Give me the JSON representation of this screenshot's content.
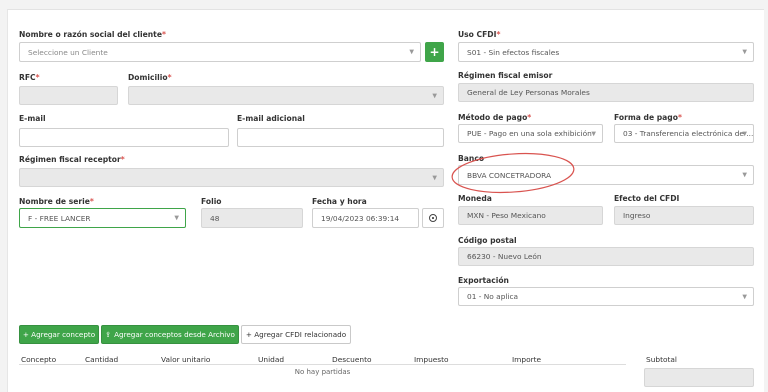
{
  "client": {
    "label": "Nombre o razón social del cliente",
    "placeholder": "Seleccione un Cliente",
    "add_button": "+"
  },
  "rfc": {
    "label": "RFC"
  },
  "domicilio": {
    "label": "Domicilio"
  },
  "email": {
    "label": "E-mail"
  },
  "email_adicional": {
    "label": "E-mail adicional"
  },
  "regimen_receptor": {
    "label": "Régimen fiscal receptor"
  },
  "serie": {
    "label": "Nombre de serie",
    "value": "F - FREE LANCER"
  },
  "folio": {
    "label": "Folio",
    "value": "48"
  },
  "fecha": {
    "label": "Fecha y hora",
    "value": "19/04/2023 06:39:14"
  },
  "uso_cfdi": {
    "label": "Uso CFDI",
    "value": "S01 - Sin efectos fiscales"
  },
  "regimen_emisor": {
    "label": "Régimen fiscal emisor",
    "value": "General de Ley Personas Morales"
  },
  "metodo_pago": {
    "label": "Método de pago",
    "value": "PUE - Pago en una sola exhibición"
  },
  "forma_pago": {
    "label": "Forma de pago",
    "value": "03 - Transferencia electrónica de ..."
  },
  "banco": {
    "label": "Banco",
    "value": "BBVA CONCETRADORA"
  },
  "moneda": {
    "label": "Moneda",
    "value": "MXN - Peso Mexicano"
  },
  "efecto": {
    "label": "Efecto del CFDI",
    "value": "Ingreso"
  },
  "codigo_postal": {
    "label": "Código postal",
    "value": "66230 - Nuevo León"
  },
  "exportacion": {
    "label": "Exportación",
    "value": "01 - No aplica"
  },
  "buttons": {
    "agregar_concepto": "+ Agregar concepto",
    "agregar_archivo": "Agregar conceptos desde Archivo",
    "agregar_cfdi": "+ Agregar CFDI relacionado"
  },
  "table": {
    "headers": [
      "Concepto",
      "Cantidad",
      "Valor unitario",
      "Unidad",
      "Descuento",
      "Impuesto",
      "Importe"
    ],
    "empty": "No hay partidas"
  },
  "subtotal": {
    "label": "Subtotal"
  },
  "colors": {
    "accent": "#3fa549",
    "required": "#d9534f",
    "annotation": "#d9534f"
  }
}
